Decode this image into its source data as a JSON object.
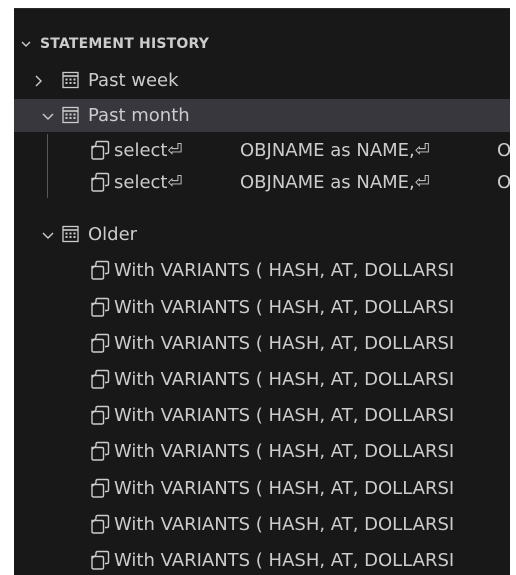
{
  "section": {
    "title": "STATEMENT HISTORY",
    "icon": "chevron-down-icon"
  },
  "groups": [
    {
      "label": "Past week",
      "icon": "calendar-icon",
      "state": "collapsed",
      "items": []
    },
    {
      "label": "Past month",
      "icon": "calendar-icon",
      "state": "expanded",
      "selected": true,
      "items": [
        {
          "col1": "select⏎",
          "col2": "OBJNAME as NAME,⏎",
          "col3": "O"
        },
        {
          "col1": "select⏎",
          "col2": "OBJNAME as NAME,⏎",
          "col3": "O"
        }
      ]
    },
    {
      "label": "Older",
      "icon": "calendar-icon",
      "state": "expanded",
      "items": [
        {
          "text": "With VARIANTS ( HASH, AT, DOLLARSI"
        },
        {
          "text": "With VARIANTS ( HASH, AT, DOLLARSI"
        },
        {
          "text": "With VARIANTS ( HASH, AT, DOLLARSI"
        },
        {
          "text": "With VARIANTS ( HASH, AT, DOLLARSI"
        },
        {
          "text": "With VARIANTS ( HASH, AT, DOLLARSI"
        },
        {
          "text": "With VARIANTS ( HASH, AT, DOLLARSI"
        },
        {
          "text": "With VARIANTS ( HASH, AT, DOLLARSI"
        },
        {
          "text": "With VARIANTS ( HASH, AT, DOLLARSI"
        },
        {
          "text": "With VARIANTS ( HASH, AT, DOLLARSI"
        }
      ]
    }
  ],
  "colors": {
    "background": "#181818",
    "selected": "#37373d",
    "text": "#cccccc",
    "guide": "#585858"
  }
}
